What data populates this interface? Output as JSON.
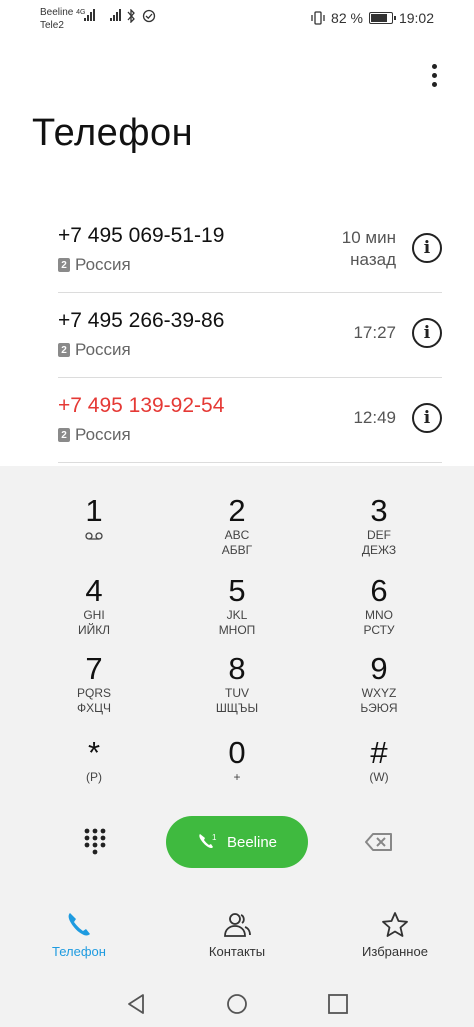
{
  "status_bar": {
    "carrier1": "Beeline",
    "carrier2": "Tele2",
    "network_type": "4G",
    "battery_text": "82 %",
    "battery_level": 0.82,
    "time": "19:02"
  },
  "header": {
    "title": "Телефон"
  },
  "calls": [
    {
      "number": "+7 495 069-51-19",
      "sim": "2",
      "location": "Россия",
      "time": "10 мин\nназад",
      "missed": false
    },
    {
      "number": "+7 495 266-39-86",
      "sim": "2",
      "location": "Россия",
      "time": "17:27",
      "missed": false
    },
    {
      "number": "+7 495 139-92-54",
      "sim": "2",
      "location": "Россия",
      "time": "12:49",
      "missed": true
    }
  ],
  "dialpad": {
    "keys": [
      {
        "digit": "1",
        "latin": "",
        "cyr": ""
      },
      {
        "digit": "2",
        "latin": "ABC",
        "cyr": "АБВГ"
      },
      {
        "digit": "3",
        "latin": "DEF",
        "cyr": "ДЕЖЗ"
      },
      {
        "digit": "4",
        "latin": "GHI",
        "cyr": "ИЙКЛ"
      },
      {
        "digit": "5",
        "latin": "JKL",
        "cyr": "МНОП"
      },
      {
        "digit": "6",
        "latin": "MNO",
        "cyr": "РСТУ"
      },
      {
        "digit": "7",
        "latin": "PQRS",
        "cyr": "ФХЦЧ"
      },
      {
        "digit": "8",
        "latin": "TUV",
        "cyr": "ШЩЪЫ"
      },
      {
        "digit": "9",
        "latin": "WXYZ",
        "cyr": "ЬЭЮЯ"
      },
      {
        "digit": "*",
        "latin": "(P)",
        "cyr": ""
      },
      {
        "digit": "0",
        "latin": "+",
        "cyr": ""
      },
      {
        "digit": "#",
        "latin": "(W)",
        "cyr": ""
      }
    ],
    "call_button_label": "Beeline",
    "call_button_sim": "1"
  },
  "bottom_nav": {
    "items": [
      {
        "label": "Телефон",
        "icon": "phone-icon",
        "active": true
      },
      {
        "label": "Контакты",
        "icon": "contacts-icon",
        "active": false
      },
      {
        "label": "Избранное",
        "icon": "star-icon",
        "active": false
      }
    ]
  },
  "colors": {
    "accent": "#1e9be0",
    "call_green": "#3fba3f",
    "missed_red": "#e53935"
  }
}
